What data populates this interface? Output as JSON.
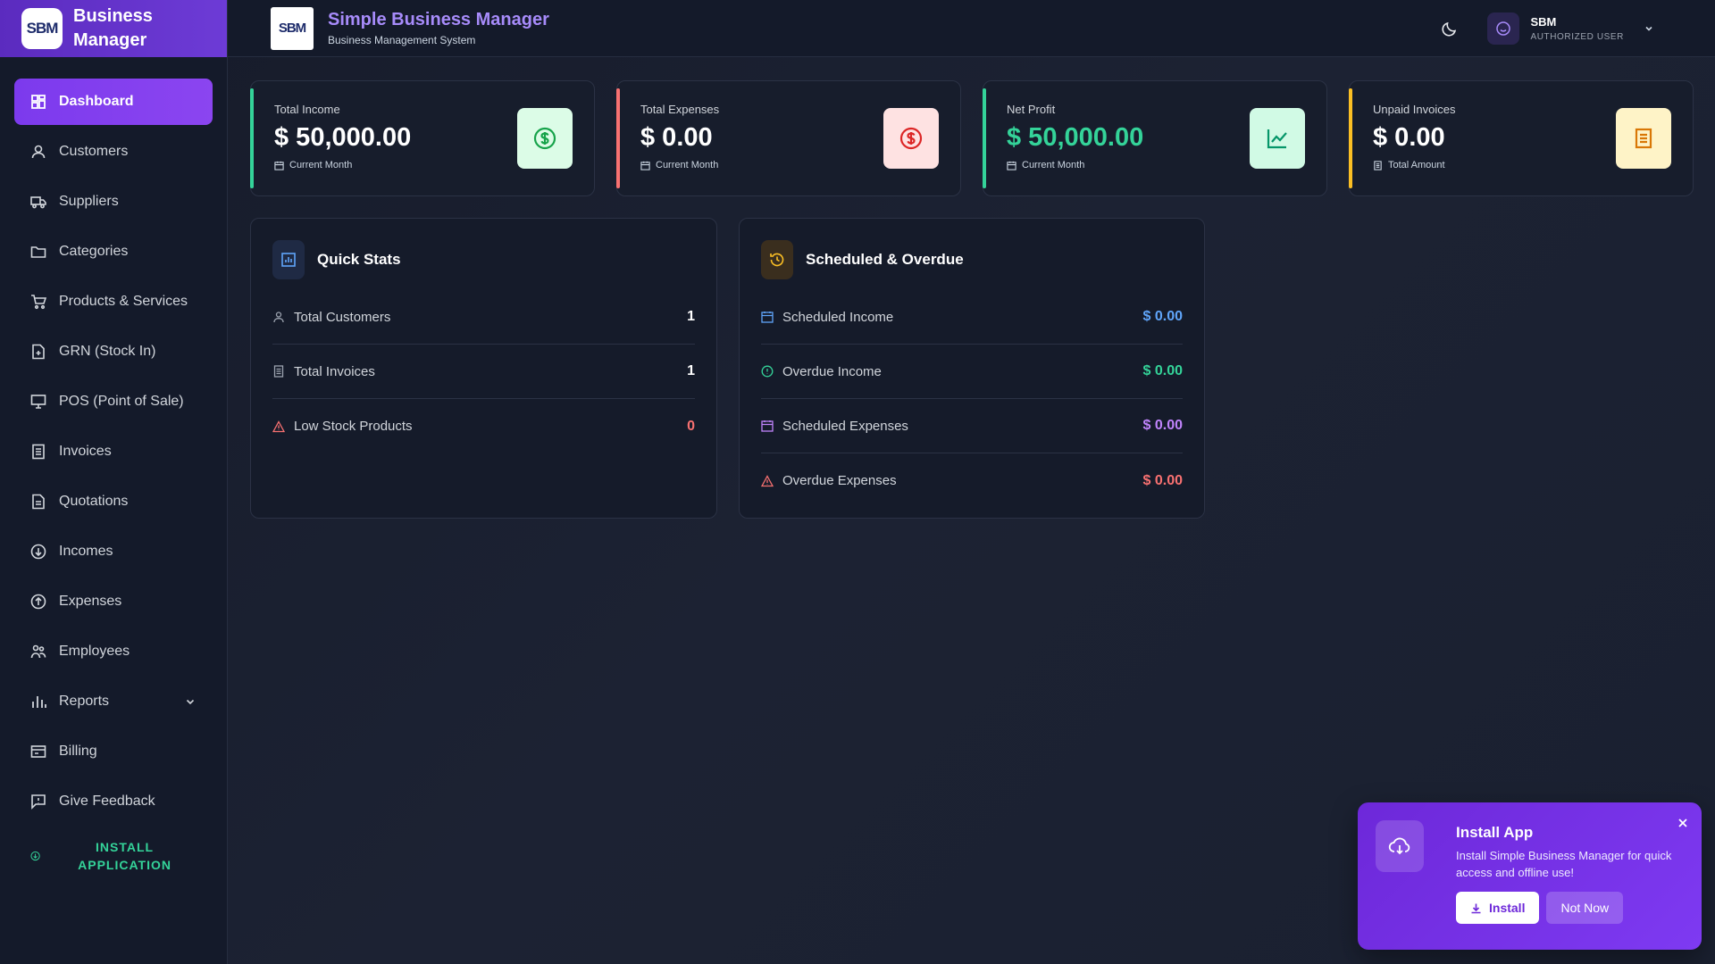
{
  "sidebar": {
    "brand": {
      "logo_text": "SBM",
      "title": "Business Manager"
    },
    "items": [
      {
        "label": "Dashboard",
        "icon": "grid-icon",
        "active": true
      },
      {
        "label": "Customers",
        "icon": "user-icon"
      },
      {
        "label": "Suppliers",
        "icon": "truck-icon"
      },
      {
        "label": "Categories",
        "icon": "folder-icon"
      },
      {
        "label": "Products & Services",
        "icon": "cart-icon"
      },
      {
        "label": "GRN (Stock In)",
        "icon": "file-plus-icon"
      },
      {
        "label": "POS (Point of Sale)",
        "icon": "monitor-icon"
      },
      {
        "label": "Invoices",
        "icon": "invoice-icon"
      },
      {
        "label": "Quotations",
        "icon": "quote-doc-icon"
      },
      {
        "label": "Incomes",
        "icon": "arrow-down-circle-icon"
      },
      {
        "label": "Expenses",
        "icon": "arrow-up-circle-icon"
      },
      {
        "label": "Employees",
        "icon": "people-icon"
      },
      {
        "label": "Reports",
        "icon": "bar-chart-icon",
        "expandable": true
      },
      {
        "label": "Billing",
        "icon": "billing-icon"
      },
      {
        "label": "Give Feedback",
        "icon": "feedback-icon"
      }
    ],
    "install": {
      "label": "INSTALL APPLICATION",
      "icon": "cloud-download-icon"
    }
  },
  "header": {
    "logo_text": "SBM",
    "title": "Simple Business Manager",
    "subtitle": "Business Management System",
    "theme_icon": "moon-icon",
    "user": {
      "name": "SBM",
      "role": "AUTHORIZED USER"
    }
  },
  "stats": [
    {
      "label": "Total Income",
      "value": "$ 50,000.00",
      "sub": "Current Month",
      "accent": "#34d399",
      "icon": "dollar-circle-icon",
      "icon_bg": "#dcfce7",
      "icon_color": "#16a34a",
      "value_color": "#ffffff"
    },
    {
      "label": "Total Expenses",
      "value": "$ 0.00",
      "sub": "Current Month",
      "accent": "#f87171",
      "icon": "dollar-circle-icon",
      "icon_bg": "#fee2e2",
      "icon_color": "#dc2626",
      "value_color": "#ffffff"
    },
    {
      "label": "Net Profit",
      "value": "$ 50,000.00",
      "sub": "Current Month",
      "accent": "#34d399",
      "icon": "trend-chart-icon",
      "icon_bg": "#d1fae5",
      "icon_color": "#059669",
      "value_color": "#34d399"
    },
    {
      "label": "Unpaid Invoices",
      "value": "$ 0.00",
      "sub": "Total Amount",
      "accent": "#fbbf24",
      "icon": "document-icon",
      "icon_bg": "#fef3c7",
      "icon_color": "#d97706",
      "value_color": "#ffffff"
    }
  ],
  "quick_stats": {
    "title": "Quick Stats",
    "rows": [
      {
        "label": "Total Customers",
        "value": "1",
        "color": "#ffffff"
      },
      {
        "label": "Total Invoices",
        "value": "1",
        "color": "#ffffff"
      },
      {
        "label": "Low Stock Products",
        "value": "0",
        "color": "#f87171"
      }
    ]
  },
  "scheduled": {
    "title": "Scheduled & Overdue",
    "rows": [
      {
        "label": "Scheduled Income",
        "value": "$ 0.00",
        "color": "#60a5fa"
      },
      {
        "label": "Overdue Income",
        "value": "$ 0.00",
        "color": "#34d399"
      },
      {
        "label": "Scheduled Expenses",
        "value": "$ 0.00",
        "color": "#c084fc"
      },
      {
        "label": "Overdue Expenses",
        "value": "$ 0.00",
        "color": "#f87171"
      }
    ]
  },
  "toast": {
    "title": "Install App",
    "text": "Install Simple Business Manager for quick access and offline use!",
    "install_label": "Install",
    "later_label": "Not Now"
  }
}
